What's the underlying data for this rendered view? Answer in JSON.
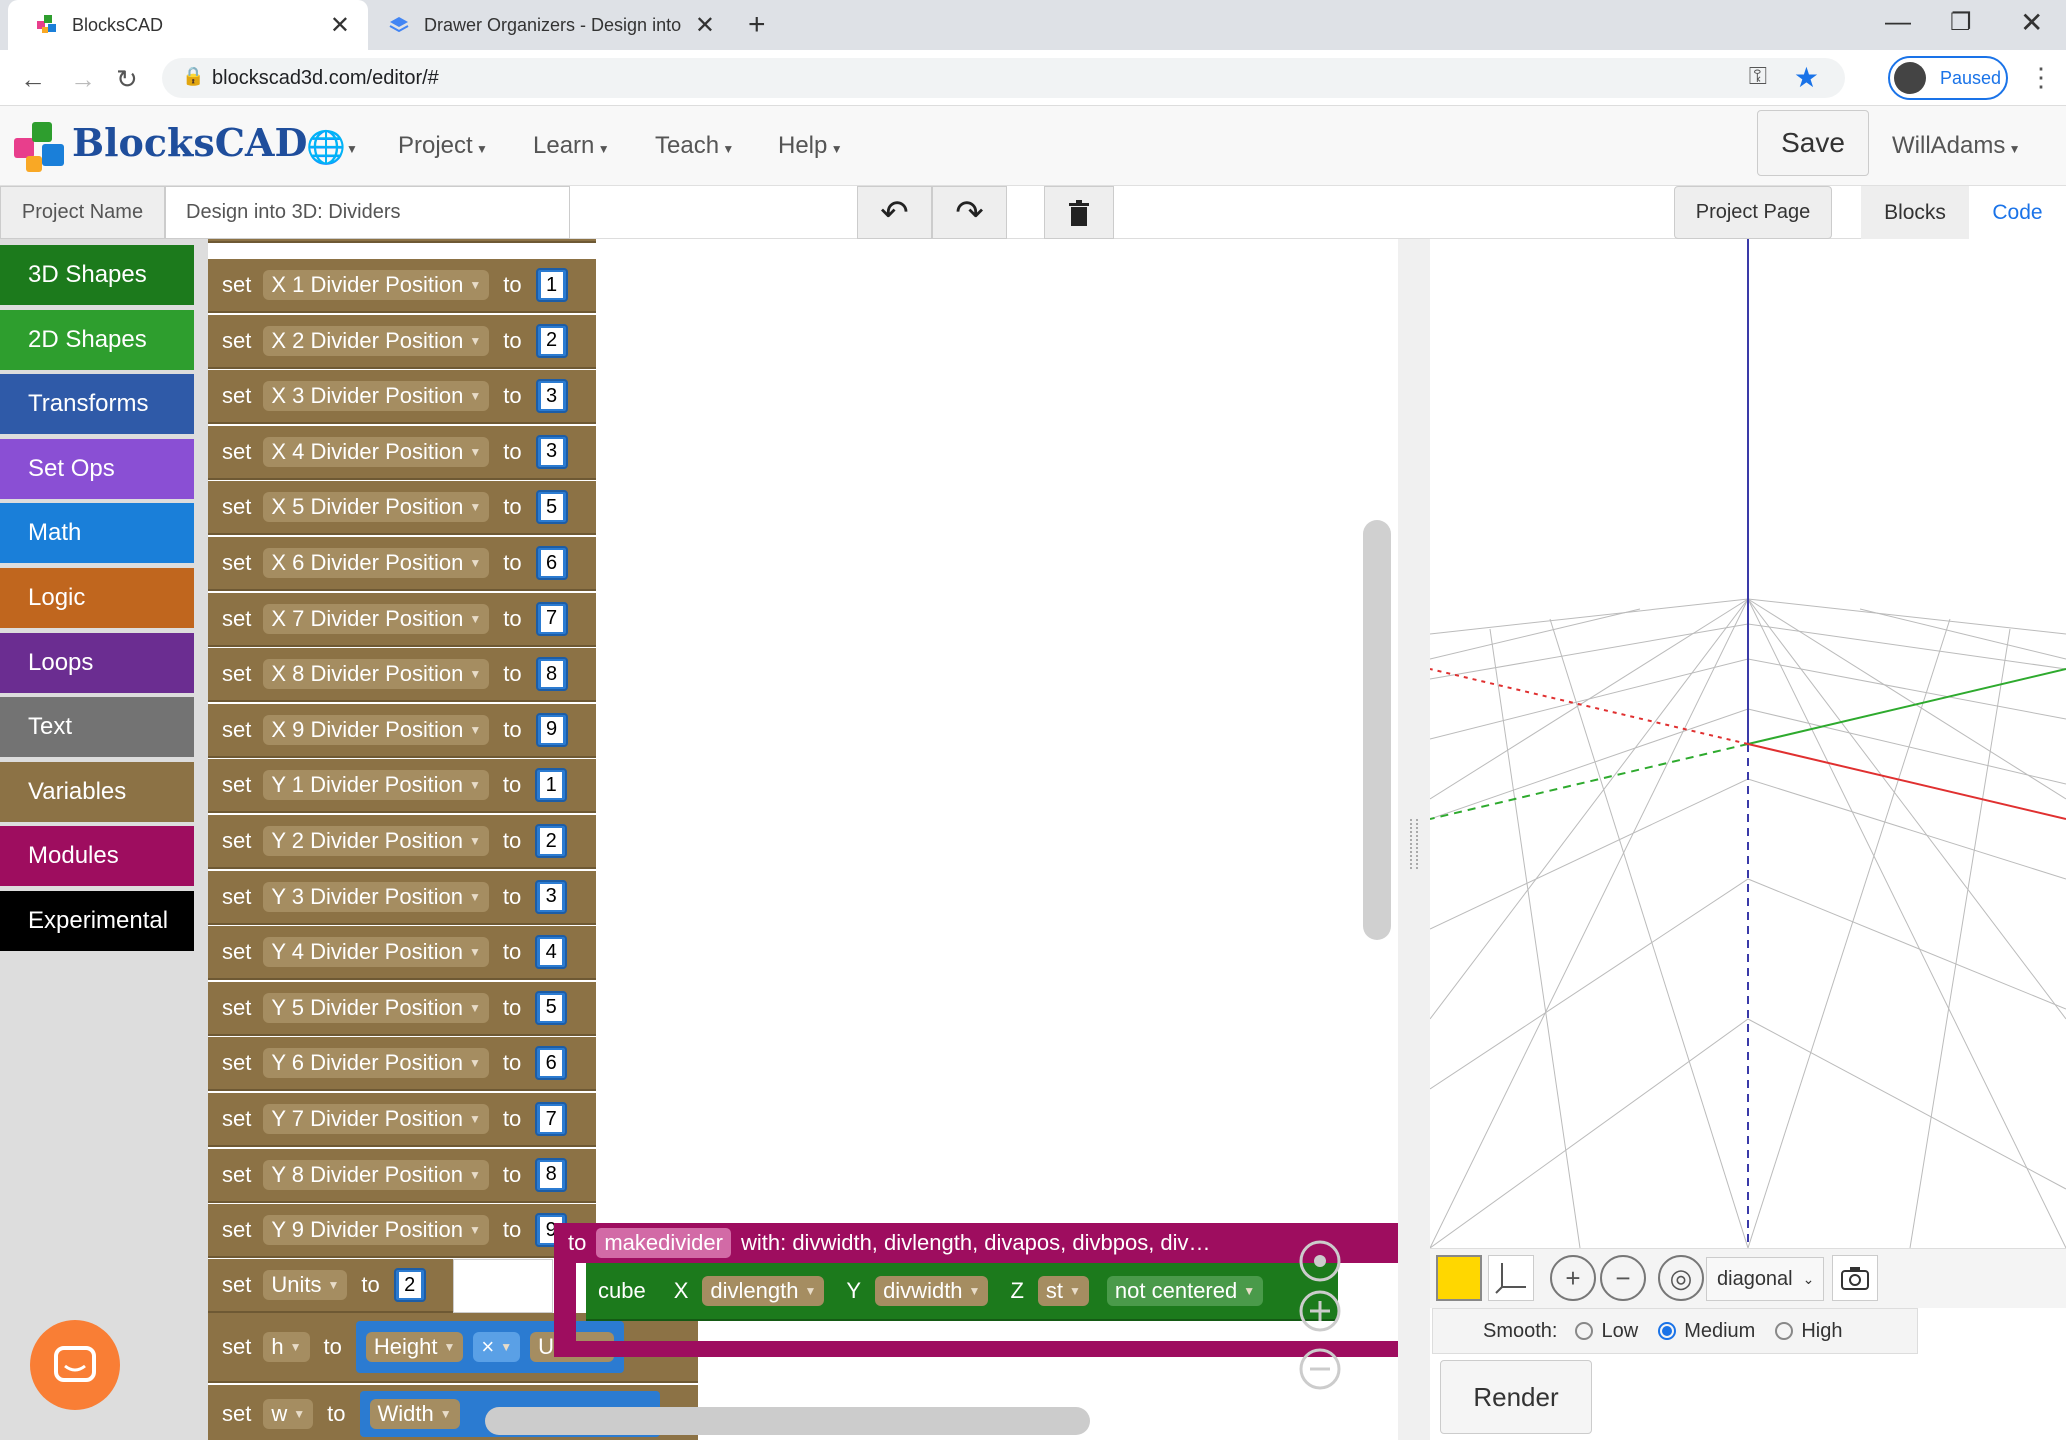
{
  "browser": {
    "tabs": [
      {
        "title": "BlocksCAD",
        "active": true
      },
      {
        "title": "Drawer Organizers - Design into",
        "active": false
      }
    ],
    "url": "blockscad3d.com/editor/#",
    "profile_status": "Paused"
  },
  "app": {
    "logo": "BlocksCAD",
    "menu": [
      "Project",
      "Learn",
      "Teach",
      "Help"
    ],
    "save_label": "Save",
    "user": "WillAdams"
  },
  "project": {
    "name_label": "Project Name",
    "name_value": "Design into 3D: Dividers",
    "project_page": "Project Page",
    "view_tabs": [
      "Blocks",
      "Code"
    ]
  },
  "categories": [
    {
      "label": "3D Shapes",
      "color": "#1c7a1c"
    },
    {
      "label": "2D Shapes",
      "color": "#2e9e2e"
    },
    {
      "label": "Transforms",
      "color": "#2f5aa8"
    },
    {
      "label": "Set Ops",
      "color": "#8a4fd4"
    },
    {
      "label": "Math",
      "color": "#1a7fd9"
    },
    {
      "label": "Logic",
      "color": "#c0661e"
    },
    {
      "label": "Loops",
      "color": "#6b2d91"
    },
    {
      "label": "Text",
      "color": "#737373"
    },
    {
      "label": "Variables",
      "color": "#8c7245"
    },
    {
      "label": "Modules",
      "color": "#9e0d5f"
    },
    {
      "label": "Experimental",
      "color": "#000000"
    }
  ],
  "blocks": {
    "set": "set",
    "to": "to",
    "divider_rows": [
      {
        "var": "X 1 Divider Position",
        "val": "1"
      },
      {
        "var": "X 2 Divider Position",
        "val": "2"
      },
      {
        "var": "X 3 Divider Position",
        "val": "3"
      },
      {
        "var": "X 4 Divider Position",
        "val": "3"
      },
      {
        "var": "X 5 Divider Position",
        "val": "5"
      },
      {
        "var": "X 6 Divider Position",
        "val": "6"
      },
      {
        "var": "X 7 Divider Position",
        "val": "7"
      },
      {
        "var": "X 8 Divider Position",
        "val": "8"
      },
      {
        "var": "X 9 Divider Position",
        "val": "9"
      },
      {
        "var": "Y 1 Divider Position",
        "val": "1"
      },
      {
        "var": "Y 2 Divider Position",
        "val": "2"
      },
      {
        "var": "Y 3 Divider Position",
        "val": "3"
      },
      {
        "var": "Y 4 Divider Position",
        "val": "4"
      },
      {
        "var": "Y 5 Divider Position",
        "val": "5"
      },
      {
        "var": "Y 6 Divider Position",
        "val": "6"
      },
      {
        "var": "Y 7 Divider Position",
        "val": "7"
      },
      {
        "var": "Y 8 Divider Position",
        "val": "8"
      },
      {
        "var": "Y 9 Divider Position",
        "val": "9"
      }
    ],
    "units_row": {
      "var": "Units",
      "val": "2"
    },
    "h_row": {
      "var": "h",
      "a": "Height",
      "op": "×",
      "b": "Units"
    },
    "w_row": {
      "var": "w",
      "a": "Width"
    },
    "module": {
      "to": "to",
      "name": "makedivider",
      "params": "with: divwidth, divlength, divapos, divbpos, div…"
    },
    "cube": {
      "label": "cube",
      "x_label": "X",
      "x_val": "divlength",
      "y_label": "Y",
      "y_val": "divwidth",
      "z_label": "Z",
      "z_val": "st",
      "center": "not centered"
    }
  },
  "viewer": {
    "view_select": "diagonal",
    "smooth_label": "Smooth:",
    "smooth_options": [
      "Low",
      "Medium",
      "High"
    ],
    "smooth_selected": "Medium",
    "render_label": "Render",
    "color_swatch": "#ffd700"
  }
}
